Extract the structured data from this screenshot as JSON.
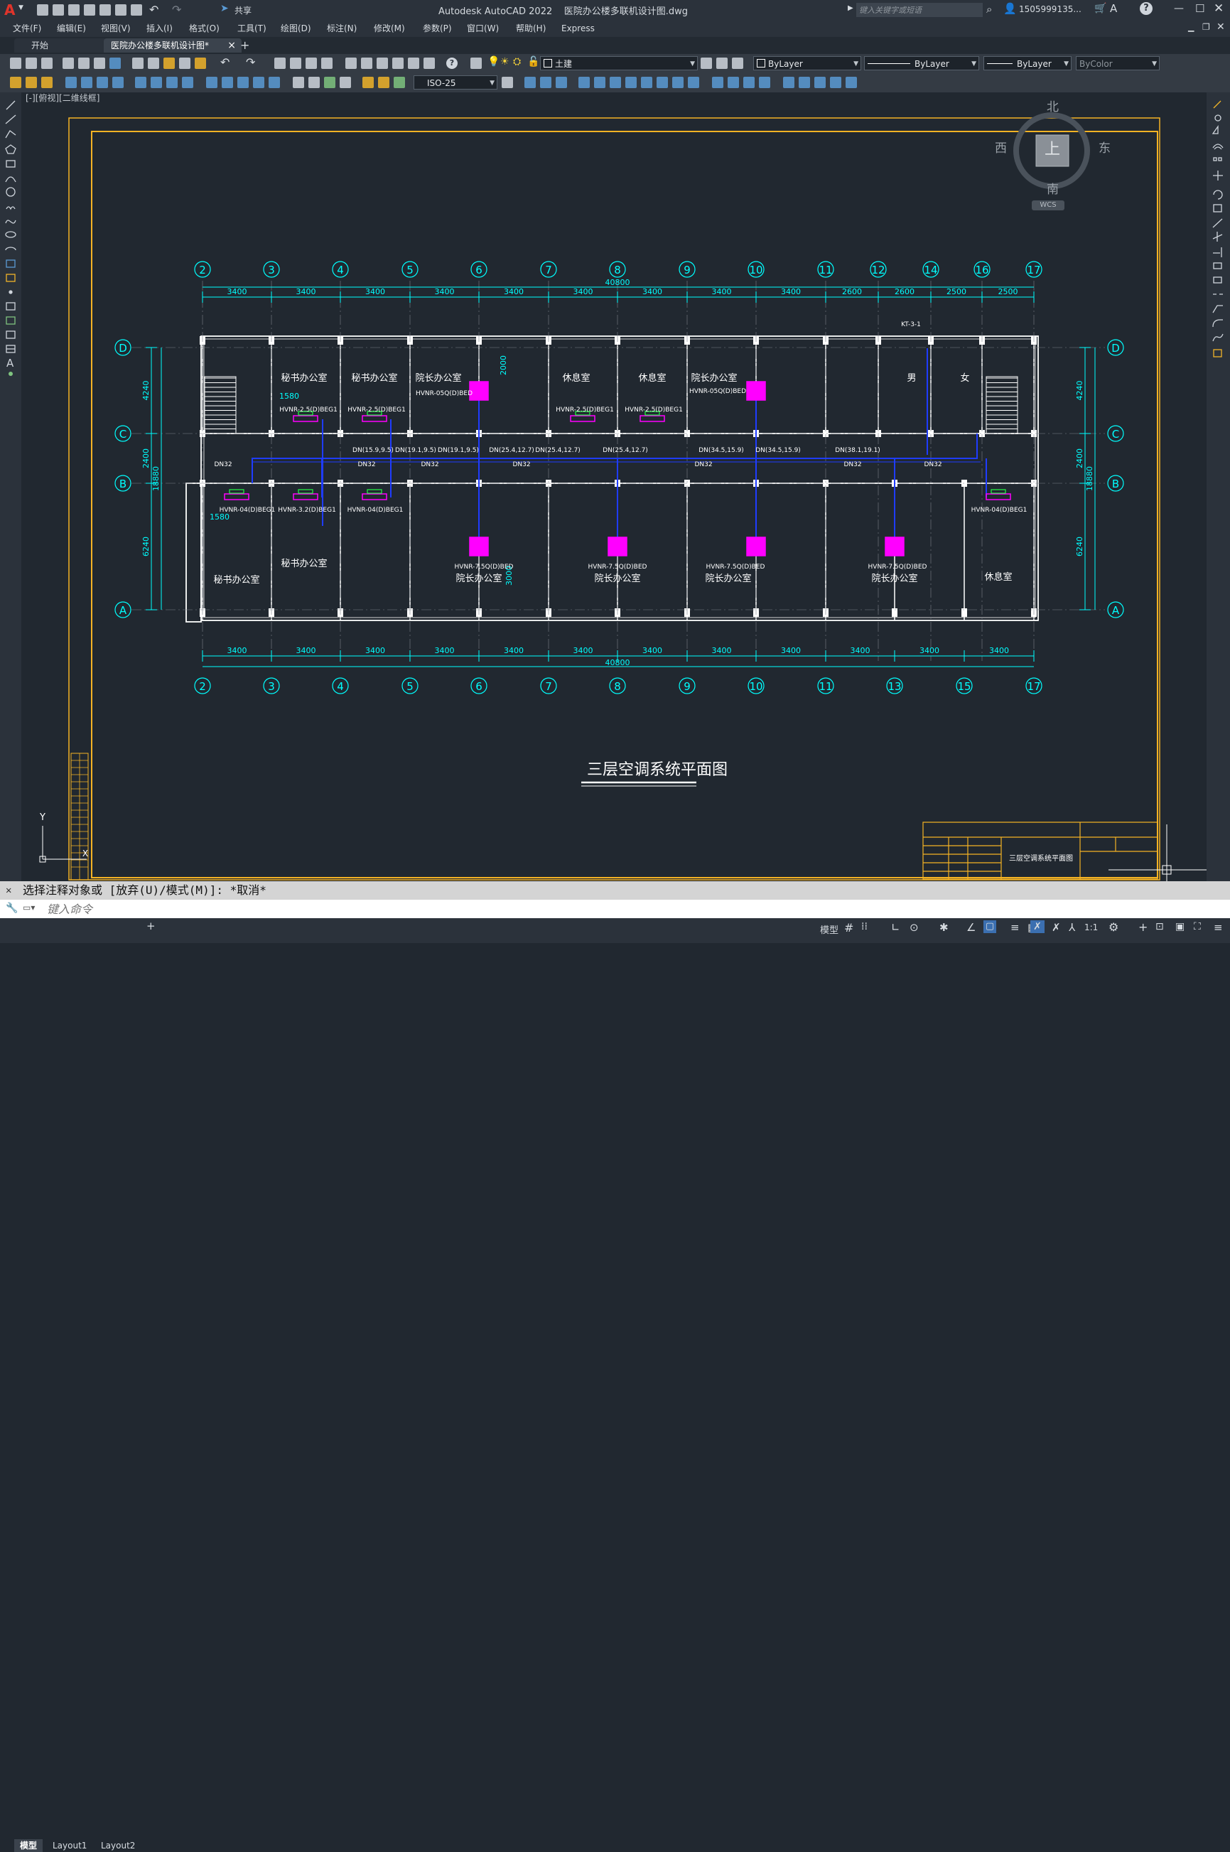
{
  "titlebar": {
    "app_logo": "A",
    "share": "共享",
    "title": "Autodesk AutoCAD 2022    医院办公楼多联机设计图.dwg",
    "search_placeholder": "键入关键字或短语",
    "user": "1505999135...",
    "help": "?"
  },
  "menu": [
    "文件(F)",
    "编辑(E)",
    "视图(V)",
    "插入(I)",
    "格式(O)",
    "工具(T)",
    "绘图(D)",
    "标注(N)",
    "修改(M)",
    "参数(P)",
    "窗口(W)",
    "帮助(H)",
    "Express"
  ],
  "tabs": {
    "start": "开始",
    "drawing": "医院办公楼多联机设计图*",
    "close": "×",
    "add": "+"
  },
  "toolbar1": {
    "layer": "土建",
    "color": "ByLayer",
    "linetype": "ByLayer",
    "lineweight": "ByLayer",
    "plotstyle": "ByColor"
  },
  "toolbar2": {
    "dimstyle": "ISO-25"
  },
  "viewport": {
    "label": "[-][俯视][二维线框]"
  },
  "viewcube": {
    "north": "北",
    "south": "南",
    "east": "东",
    "west": "西",
    "top": "上",
    "wcs": "WCS"
  },
  "drawing": {
    "title": "三层空调系统平面图",
    "top_axes": [
      "2",
      "3",
      "4",
      "5",
      "6",
      "7",
      "8",
      "9",
      "10",
      "11",
      "12",
      "14",
      "16",
      "17"
    ],
    "bottom_axes": [
      "2",
      "3",
      "4",
      "5",
      "6",
      "7",
      "8",
      "9",
      "10",
      "11",
      "13",
      "15",
      "17"
    ],
    "top_dims": [
      "3400",
      "3400",
      "3400",
      "3400",
      "3400",
      "3400",
      "3400",
      "3400",
      "3400",
      "2600",
      "2600",
      "2500",
      "2500"
    ],
    "bottom_dims": [
      "3400",
      "3400",
      "3400",
      "3400",
      "3400",
      "3400",
      "3400",
      "3400",
      "3400",
      "3400",
      "3400",
      "3400"
    ],
    "total_dim": "40800",
    "row_axes": [
      "D",
      "C",
      "B",
      "A"
    ],
    "left_dims": [
      "4240",
      "2400",
      "6240"
    ],
    "left_total": "18880",
    "right_dims": [
      "4240",
      "2400",
      "6240"
    ],
    "right_total": "18880",
    "rooms": [
      {
        "label": "秘书办公室"
      },
      {
        "label": "秘书办公室"
      },
      {
        "label": "院长办公室"
      },
      {
        "label": "休息室"
      },
      {
        "label": "休息室"
      },
      {
        "label": "院长办公室"
      },
      {
        "label": "男"
      },
      {
        "label": "女"
      },
      {
        "label": "秘书办公室"
      },
      {
        "label": "秘书办公室"
      },
      {
        "label": "院长办公室"
      },
      {
        "label": "院长办公室"
      },
      {
        "label": "院长办公室"
      },
      {
        "label": "院长办公室"
      },
      {
        "label": "休息室"
      }
    ],
    "units": [
      {
        "label": "HVNR-2.5(D)BEG1"
      },
      {
        "label": "HVNR-2.5(D)BEG1"
      },
      {
        "label": "HVNR-05Q(D)BED"
      },
      {
        "label": "HVNR-2.5(D)BEG1"
      },
      {
        "label": "HVNR-2.5(D)BEG1"
      },
      {
        "label": "HVNR-05Q(D)BED"
      },
      {
        "label": "HVNR-04(D)BEG1"
      },
      {
        "label": "HVNR-3.2(D)BEG1"
      },
      {
        "label": "HVNR-04(D)BEG1"
      },
      {
        "label": "HVNR-7.5Q(D)BED"
      },
      {
        "label": "HVNR-7.5Q(D)BED"
      },
      {
        "label": "HVNR-7.5Q(D)BED"
      },
      {
        "label": "HVNR-7.5Q(D)BED"
      },
      {
        "label": "HVNR-04(D)BEG1"
      }
    ],
    "pipes": [
      {
        "label": "DN32"
      },
      {
        "label": "DN32"
      },
      {
        "label": "DN32"
      },
      {
        "label": "DN32"
      },
      {
        "label": "DN32"
      },
      {
        "label": "DN32"
      },
      {
        "label": "DN32"
      },
      {
        "label": "DN(15.9,9.5)"
      },
      {
        "label": "DN(19.1,9.5)"
      },
      {
        "label": "DN(19.1,9.5)"
      },
      {
        "label": "DN(25.4,12.7)"
      },
      {
        "label": "DN(25.4,12.7)"
      },
      {
        "label": "DN(25.4,12.7)"
      },
      {
        "label": "DN(34.5,15.9)"
      },
      {
        "label": "DN(34.5,15.9)"
      },
      {
        "label": "DN(38.1,19.1)"
      },
      {
        "label": "KT-3-1"
      }
    ],
    "annot_dims": [
      "1580",
      "1580",
      "2000",
      "3000"
    ]
  },
  "titleblock": {
    "name": "三层空调系统平面图"
  },
  "ucs": {
    "y": "Y",
    "x": "X"
  },
  "command": {
    "history": "选择注释对象或 [放弃(U)/模式(M)]: *取消*",
    "placeholder": "键入命令"
  },
  "statusbar": {
    "tabs": [
      "模型",
      "Layout1",
      "Layout2"
    ],
    "model": "模型",
    "scale": "1:1"
  }
}
